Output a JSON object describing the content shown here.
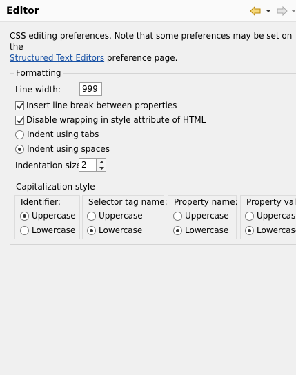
{
  "header": {
    "title": "Editor",
    "back_icon": "back-arrow-icon",
    "forward_icon": "forward-arrow-icon"
  },
  "intro": {
    "text_before": "CSS editing preferences.  Note that some preferences may be set on the",
    "link": "Structured Text Editors",
    "text_after": " preference page."
  },
  "formatting": {
    "legend": "Formatting",
    "line_width_label": "Line width:",
    "line_width_value": "999",
    "insert_line_break": {
      "label": "Insert line break between properties",
      "checked": true
    },
    "disable_wrapping": {
      "label": "Disable wrapping in style attribute of HTML",
      "checked": true
    },
    "indent_tabs": {
      "label": "Indent using tabs",
      "selected": false
    },
    "indent_spaces": {
      "label": "Indent using spaces",
      "selected": true
    },
    "indentation_size_label": "Indentation size:",
    "indentation_size_value": "2"
  },
  "capitalization": {
    "legend": "Capitalization style",
    "groups": [
      {
        "label": "Identifier:",
        "uppercase": "Uppercase",
        "lowercase": "Lowercase",
        "selected": "uppercase"
      },
      {
        "label": "Selector tag name:",
        "uppercase": "Uppercase",
        "lowercase": "Lowercase",
        "selected": "lowercase"
      },
      {
        "label": "Property name:",
        "uppercase": "Uppercase",
        "lowercase": "Lowercase",
        "selected": "lowercase"
      },
      {
        "label": "Property valu",
        "uppercase": "Uppercase",
        "lowercase": "Lowercase",
        "selected": "lowercase"
      }
    ]
  }
}
